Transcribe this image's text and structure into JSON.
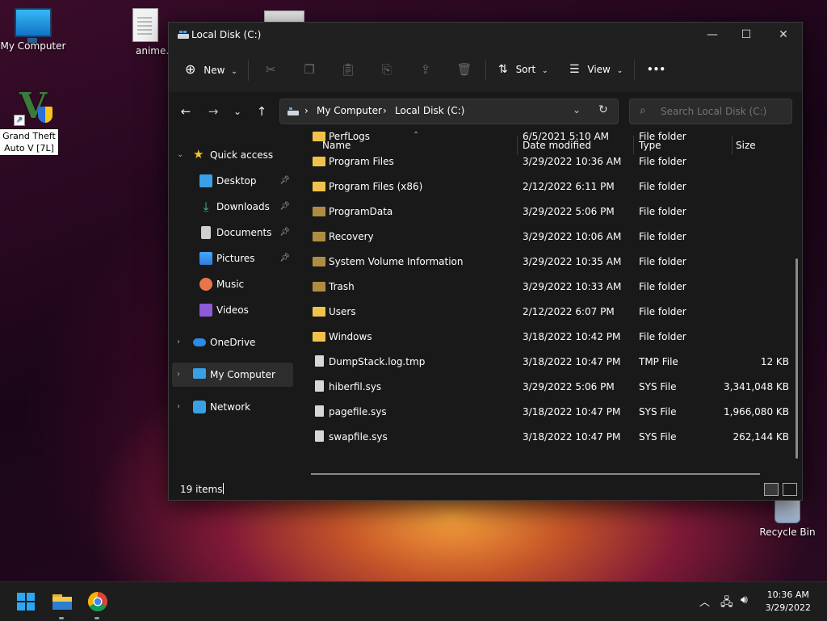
{
  "desktop": {
    "icons": [
      {
        "label": "My Computer"
      },
      {
        "label": "anime.t"
      },
      {
        "label": "Grand Theft Auto V [7L]"
      },
      {
        "label": "Recycle Bin"
      }
    ]
  },
  "window": {
    "title": "Local Disk (C:)",
    "controls": {
      "minimize": "—",
      "maximize": "☐",
      "close": "✕"
    },
    "toolbar": {
      "new_label": "New",
      "sort_label": "Sort",
      "view_label": "View",
      "more_label": "•••"
    },
    "address": {
      "crumbs": [
        "My Computer",
        "Local Disk (C:)"
      ],
      "separator": "›"
    },
    "search": {
      "placeholder": "Search Local Disk (C:)"
    },
    "columns": [
      "Name",
      "Date modified",
      "Type",
      "Size"
    ],
    "nav_pane": {
      "quick_access": "Quick access",
      "items": [
        {
          "label": "Desktop",
          "icon": "desktop-icon",
          "pinned": true
        },
        {
          "label": "Downloads",
          "icon": "downloads-icon",
          "pinned": true
        },
        {
          "label": "Documents",
          "icon": "documents-icon",
          "pinned": true
        },
        {
          "label": "Pictures",
          "icon": "pictures-icon",
          "pinned": true
        },
        {
          "label": "Music",
          "icon": "music-icon",
          "pinned": false
        },
        {
          "label": "Videos",
          "icon": "videos-icon",
          "pinned": false
        }
      ],
      "onedrive": "OneDrive",
      "my_computer": "My Computer",
      "network": "Network"
    },
    "files": [
      {
        "name": "PerfLogs",
        "date": "6/5/2021 5:10 AM",
        "type": "File folder",
        "size": "",
        "kind": "folder"
      },
      {
        "name": "Program Files",
        "date": "3/29/2022 10:36 AM",
        "type": "File folder",
        "size": "",
        "kind": "folder"
      },
      {
        "name": "Program Files (x86)",
        "date": "2/12/2022 6:11 PM",
        "type": "File folder",
        "size": "",
        "kind": "folder"
      },
      {
        "name": "ProgramData",
        "date": "3/29/2022 5:06 PM",
        "type": "File folder",
        "size": "",
        "kind": "folder-dim"
      },
      {
        "name": "Recovery",
        "date": "3/29/2022 10:06 AM",
        "type": "File folder",
        "size": "",
        "kind": "folder-dim"
      },
      {
        "name": "System Volume Information",
        "date": "3/29/2022 10:35 AM",
        "type": "File folder",
        "size": "",
        "kind": "folder-dim"
      },
      {
        "name": "Trash",
        "date": "3/29/2022 10:33 AM",
        "type": "File folder",
        "size": "",
        "kind": "folder-dim"
      },
      {
        "name": "Users",
        "date": "2/12/2022 6:07 PM",
        "type": "File folder",
        "size": "",
        "kind": "folder"
      },
      {
        "name": "Windows",
        "date": "3/18/2022 10:42 PM",
        "type": "File folder",
        "size": "",
        "kind": "folder"
      },
      {
        "name": "DumpStack.log.tmp",
        "date": "3/18/2022 10:47 PM",
        "type": "TMP File",
        "size": "12 KB",
        "kind": "file"
      },
      {
        "name": "hiberfil.sys",
        "date": "3/29/2022 5:06 PM",
        "type": "SYS File",
        "size": "3,341,048 KB",
        "kind": "file"
      },
      {
        "name": "pagefile.sys",
        "date": "3/18/2022 10:47 PM",
        "type": "SYS File",
        "size": "1,966,080 KB",
        "kind": "file"
      },
      {
        "name": "swapfile.sys",
        "date": "3/18/2022 10:47 PM",
        "type": "SYS File",
        "size": "262,144 KB",
        "kind": "file"
      }
    ],
    "status": {
      "count": "19 items"
    }
  },
  "taskbar": {
    "time": "10:36 AM",
    "date": "3/29/2022",
    "apps": [
      "start-icon",
      "file-explorer-icon",
      "chrome-icon"
    ]
  },
  "colors": {
    "folder": "#f0c14b",
    "accent": "#0078d4",
    "window_bg": "#191919"
  }
}
